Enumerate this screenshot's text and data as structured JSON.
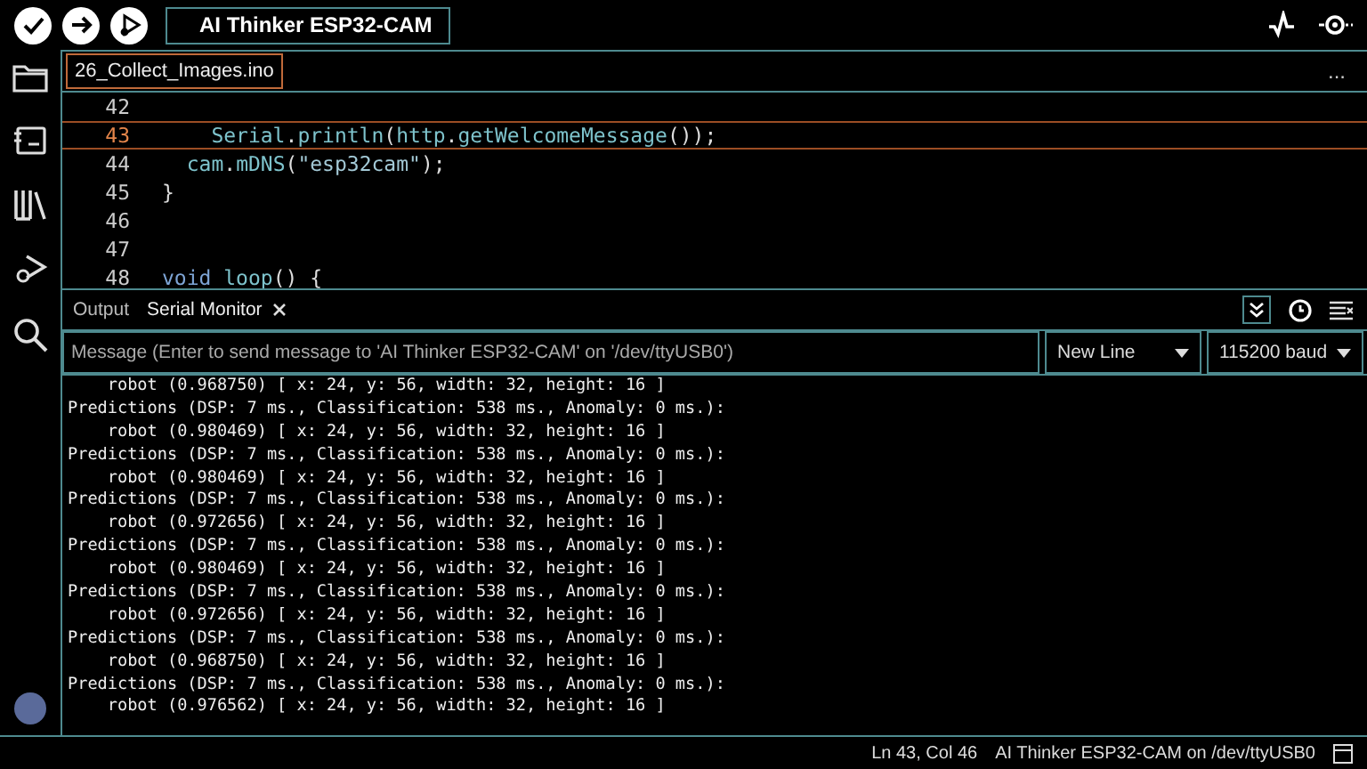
{
  "toolbar": {
    "board": "AI Thinker ESP32-CAM"
  },
  "file_tab": {
    "label": "26_Collect_Images.ino",
    "selected": true
  },
  "more": "...",
  "code": [
    {
      "number": "42",
      "current": false
    },
    {
      "number": "43",
      "current": true,
      "tokens": [
        {
          "text": "    Serial",
          "kind": "ident"
        },
        {
          "text": ".",
          "kind": "plain"
        },
        {
          "text": "println",
          "kind": "ident"
        },
        {
          "text": "(",
          "kind": "plain"
        },
        {
          "text": "http",
          "kind": "ident"
        },
        {
          "text": ".",
          "kind": "plain"
        },
        {
          "text": "getWelcomeMessage",
          "kind": "ident"
        },
        {
          "text": "());",
          "kind": "plain"
        }
      ]
    },
    {
      "number": "44",
      "current": false,
      "tokens": [
        {
          "text": "  cam",
          "kind": "ident"
        },
        {
          "text": ".",
          "kind": "plain"
        },
        {
          "text": "mDNS",
          "kind": "ident"
        },
        {
          "text": "(",
          "kind": "plain"
        },
        {
          "text": "\"esp32cam\"",
          "kind": "string"
        },
        {
          "text": ");",
          "kind": "plain"
        }
      ]
    },
    {
      "number": "45",
      "current": false,
      "tokens": [
        {
          "text": "}",
          "kind": "plain"
        }
      ]
    },
    {
      "number": "46",
      "current": false
    },
    {
      "number": "47",
      "current": false
    },
    {
      "number": "48",
      "current": false,
      "tokens": [
        {
          "text": "void",
          "kind": "keyword"
        },
        {
          "text": " loop",
          "kind": "ident"
        },
        {
          "text": "() {",
          "kind": "plain"
        }
      ]
    }
  ],
  "panel_tabs": [
    {
      "label": "Output",
      "selected": false
    },
    {
      "label": "Serial Monitor",
      "selected": true
    }
  ],
  "autoscroll": true,
  "message": {
    "placeholder": "Message (Enter to send message to 'AI Thinker ESP32-CAM' on '/dev/ttyUSB0')"
  },
  "line_ending": "New Line",
  "baud": "115200 baud",
  "serial_output": [
    "    robot (0.968750) [ x: 24, y: 56, width: 32, height: 16 ]",
    "Predictions (DSP: 7 ms., Classification: 538 ms., Anomaly: 0 ms.):",
    "    robot (0.980469) [ x: 24, y: 56, width: 32, height: 16 ]",
    "Predictions (DSP: 7 ms., Classification: 538 ms., Anomaly: 0 ms.):",
    "    robot (0.980469) [ x: 24, y: 56, width: 32, height: 16 ]",
    "Predictions (DSP: 7 ms., Classification: 538 ms., Anomaly: 0 ms.):",
    "    robot (0.972656) [ x: 24, y: 56, width: 32, height: 16 ]",
    "Predictions (DSP: 7 ms., Classification: 538 ms., Anomaly: 0 ms.):",
    "    robot (0.980469) [ x: 24, y: 56, width: 32, height: 16 ]",
    "Predictions (DSP: 7 ms., Classification: 538 ms., Anomaly: 0 ms.):",
    "    robot (0.972656) [ x: 24, y: 56, width: 32, height: 16 ]",
    "Predictions (DSP: 7 ms., Classification: 538 ms., Anomaly: 0 ms.):",
    "    robot (0.968750) [ x: 24, y: 56, width: 32, height: 16 ]",
    "Predictions (DSP: 7 ms., Classification: 538 ms., Anomaly: 0 ms.):",
    "    robot (0.976562) [ x: 24, y: 56, width: 32, height: 16 ]"
  ],
  "status_bar": {
    "position": "Ln 43, Col 46",
    "board": "AI Thinker ESP32-CAM on /dev/ttyUSB0"
  }
}
